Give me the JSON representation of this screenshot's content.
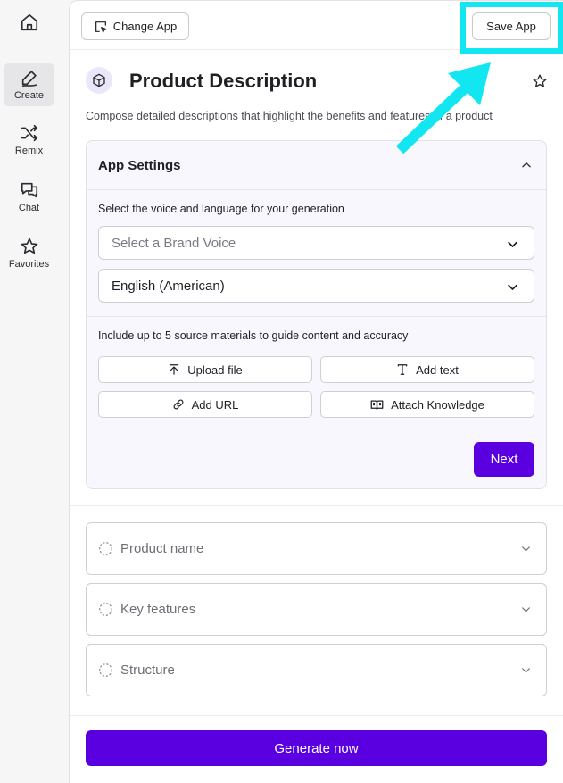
{
  "rail": {
    "items": [
      {
        "label": "",
        "icon": "home-icon"
      },
      {
        "label": "Create",
        "icon": "pen-icon"
      },
      {
        "label": "Remix",
        "icon": "shuffle-icon"
      },
      {
        "label": "Chat",
        "icon": "chat-icon"
      },
      {
        "label": "Favorites",
        "icon": "star-icon"
      }
    ]
  },
  "toolbar": {
    "change_app": "Change App",
    "save_app": "Save App"
  },
  "app": {
    "title": "Product Description",
    "description": "Compose detailed descriptions that highlight the benefits and features of a product"
  },
  "settings": {
    "title": "App Settings",
    "voice_prompt": "Select the voice and language for your generation",
    "brand_voice_placeholder": "Select a Brand Voice",
    "language_value": "English (American)",
    "sources_prompt": "Include up to 5 source materials to guide content and accuracy",
    "upload_file": "Upload file",
    "add_text": "Add text",
    "add_url": "Add URL",
    "attach_knowledge": "Attach Knowledge",
    "next": "Next"
  },
  "fields": [
    {
      "label": "Product name"
    },
    {
      "label": "Key features"
    },
    {
      "label": "Structure"
    }
  ],
  "generate": "Generate now",
  "colors": {
    "accent": "#5a00e0",
    "highlight": "#12e6f0"
  }
}
